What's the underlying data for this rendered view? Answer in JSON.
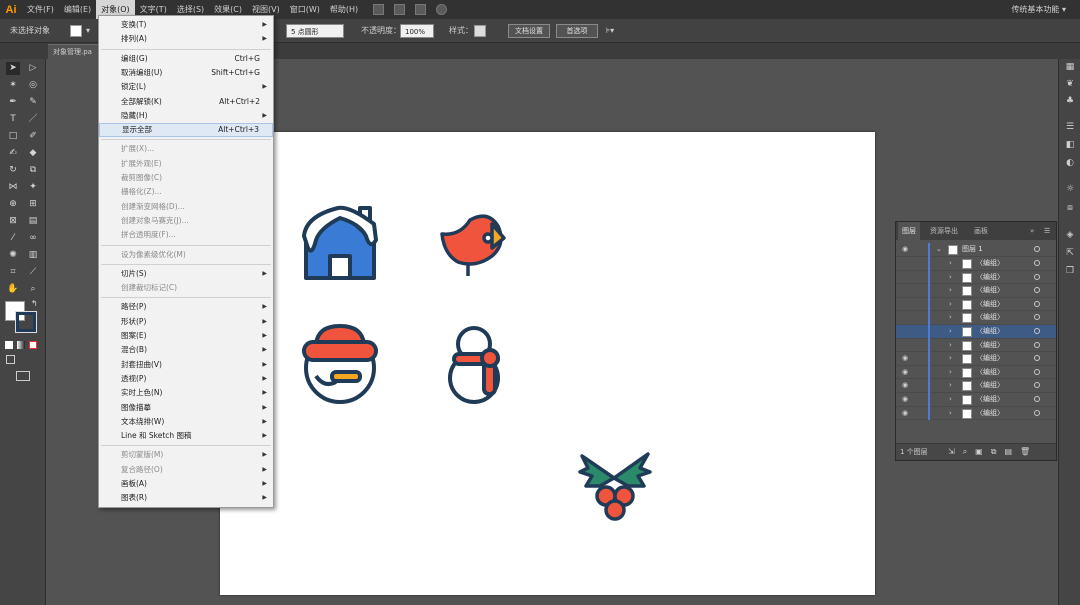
{
  "app": {
    "logo": "Ai",
    "workspace": "传统基本功能 ▾"
  },
  "menubar": {
    "items": [
      {
        "label": "文件(F)",
        "active": false
      },
      {
        "label": "编辑(E)",
        "active": false
      },
      {
        "label": "对象(O)",
        "active": true
      },
      {
        "label": "文字(T)",
        "active": false
      },
      {
        "label": "选择(S)",
        "active": false
      },
      {
        "label": "效果(C)",
        "active": false
      },
      {
        "label": "视图(V)",
        "active": false
      },
      {
        "label": "窗口(W)",
        "active": false
      },
      {
        "label": "帮助(H)",
        "active": false
      }
    ]
  },
  "controlbar": {
    "selection": "未选择对象",
    "stroke_width": "5 点圆形",
    "opacity_label": "不透明度：",
    "opacity_value": "100%",
    "style_label": "样式：",
    "doc_setup": "文档设置",
    "preferences": "首选项"
  },
  "document": {
    "tab": "对象管理.pa"
  },
  "object_menu": {
    "items": [
      {
        "label": "变换(T)",
        "shortcut": "",
        "submenu": true,
        "disabled": false
      },
      {
        "label": "排列(A)",
        "shortcut": "",
        "submenu": true,
        "disabled": false
      },
      {
        "sep": true
      },
      {
        "label": "编组(G)",
        "shortcut": "Ctrl+G",
        "submenu": false,
        "disabled": false
      },
      {
        "label": "取消编组(U)",
        "shortcut": "Shift+Ctrl+G",
        "submenu": false,
        "disabled": false
      },
      {
        "label": "锁定(L)",
        "shortcut": "",
        "submenu": true,
        "disabled": false
      },
      {
        "label": "全部解锁(K)",
        "shortcut": "Alt+Ctrl+2",
        "submenu": false,
        "disabled": false
      },
      {
        "label": "隐藏(H)",
        "shortcut": "",
        "submenu": true,
        "disabled": false
      },
      {
        "label": "显示全部",
        "shortcut": "Alt+Ctrl+3",
        "submenu": false,
        "disabled": false,
        "highlight": true
      },
      {
        "sep": true
      },
      {
        "label": "扩展(X)...",
        "shortcut": "",
        "submenu": false,
        "disabled": true
      },
      {
        "label": "扩展外观(E)",
        "shortcut": "",
        "submenu": false,
        "disabled": true
      },
      {
        "label": "裁剪图像(C)",
        "shortcut": "",
        "submenu": false,
        "disabled": true
      },
      {
        "label": "栅格化(Z)...",
        "shortcut": "",
        "submenu": false,
        "disabled": true
      },
      {
        "label": "创建渐变网格(D)...",
        "shortcut": "",
        "submenu": false,
        "disabled": true
      },
      {
        "label": "创建对象马赛克(J)...",
        "shortcut": "",
        "submenu": false,
        "disabled": true
      },
      {
        "label": "拼合透明度(F)...",
        "shortcut": "",
        "submenu": false,
        "disabled": true
      },
      {
        "sep": true
      },
      {
        "label": "设为像素级优化(M)",
        "shortcut": "",
        "submenu": false,
        "disabled": true
      },
      {
        "sep": true
      },
      {
        "label": "切片(S)",
        "shortcut": "",
        "submenu": true,
        "disabled": false
      },
      {
        "label": "创建裁切标记(C)",
        "shortcut": "",
        "submenu": false,
        "disabled": true
      },
      {
        "sep": true
      },
      {
        "label": "路径(P)",
        "shortcut": "",
        "submenu": true,
        "disabled": false
      },
      {
        "label": "形状(P)",
        "shortcut": "",
        "submenu": true,
        "disabled": false
      },
      {
        "label": "图案(E)",
        "shortcut": "",
        "submenu": true,
        "disabled": false
      },
      {
        "label": "混合(B)",
        "shortcut": "",
        "submenu": true,
        "disabled": false
      },
      {
        "label": "封套扭曲(V)",
        "shortcut": "",
        "submenu": true,
        "disabled": false
      },
      {
        "label": "透视(P)",
        "shortcut": "",
        "submenu": true,
        "disabled": false
      },
      {
        "label": "实时上色(N)",
        "shortcut": "",
        "submenu": true,
        "disabled": false
      },
      {
        "label": "图像描摹",
        "shortcut": "",
        "submenu": true,
        "disabled": false
      },
      {
        "label": "文本绕排(W)",
        "shortcut": "",
        "submenu": true,
        "disabled": false
      },
      {
        "label": "Line 和 Sketch 图稿",
        "shortcut": "",
        "submenu": true,
        "disabled": false
      },
      {
        "sep": true
      },
      {
        "label": "剪切蒙版(M)",
        "shortcut": "",
        "submenu": true,
        "disabled": true
      },
      {
        "label": "复合路径(O)",
        "shortcut": "",
        "submenu": true,
        "disabled": true
      },
      {
        "label": "画板(A)",
        "shortcut": "",
        "submenu": true,
        "disabled": false
      },
      {
        "label": "图表(R)",
        "shortcut": "",
        "submenu": true,
        "disabled": false
      }
    ]
  },
  "layers_panel": {
    "tabs": [
      "图层",
      "资源导出",
      "画板"
    ],
    "layer_name": "图层 1",
    "rows": [
      {
        "name": "〈编组〉",
        "visible": false,
        "selected": false
      },
      {
        "name": "〈编组〉",
        "visible": false,
        "selected": false
      },
      {
        "name": "〈编组〉",
        "visible": false,
        "selected": false
      },
      {
        "name": "〈编组〉",
        "visible": false,
        "selected": false
      },
      {
        "name": "〈编组〉",
        "visible": false,
        "selected": false
      },
      {
        "name": "〈编组〉",
        "visible": false,
        "selected": true
      },
      {
        "name": "〈编组〉",
        "visible": false,
        "selected": false
      },
      {
        "name": "〈编组〉",
        "visible": true,
        "selected": false
      },
      {
        "name": "〈编组〉",
        "visible": true,
        "selected": false
      },
      {
        "name": "〈编组〉",
        "visible": true,
        "selected": false
      },
      {
        "name": "〈编组〉",
        "visible": true,
        "selected": false
      },
      {
        "name": "〈编组〉",
        "visible": true,
        "selected": false
      }
    ],
    "count": "1 个图层"
  },
  "colors": {
    "navy": "#1f3b57",
    "blue": "#3a7bd5",
    "red": "#f0543c",
    "orange": "#f5a623",
    "green": "#2a8a6a"
  }
}
